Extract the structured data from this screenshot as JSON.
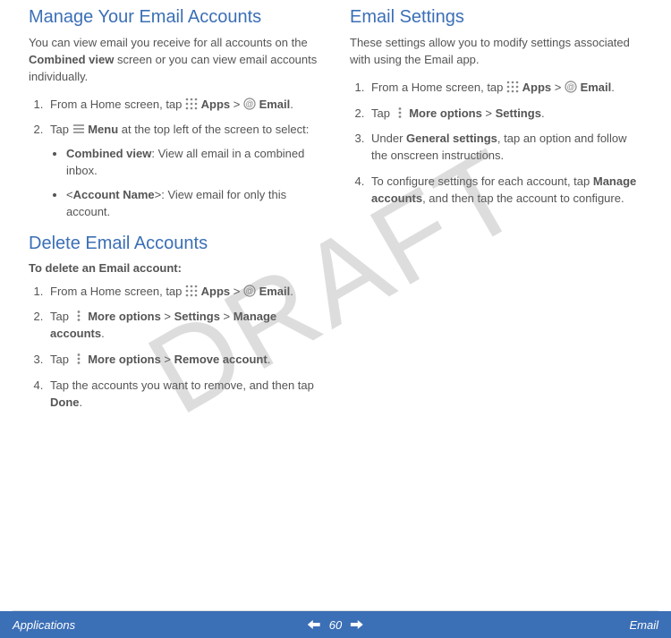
{
  "watermark": "DRAFT",
  "footer": {
    "left": "Applications",
    "page": "60",
    "right": "Email"
  },
  "left": {
    "manage": {
      "title": "Manage Your Email Accounts",
      "intro_a": "You can view email you receive for all accounts on the ",
      "intro_b": "Combined view",
      "intro_c": " screen or you can view email accounts individually.",
      "s1_a": "From a Home screen, tap ",
      "s1_apps": "Apps",
      "s1_gt": " > ",
      "s1_email": "Email",
      "s1_dot": ".",
      "s2_a": "Tap ",
      "s2_menu": "Menu",
      "s2_b": " at the top left of the screen to select:",
      "sub1_a": "Combined view",
      "sub1_b": ": View all email in a combined inbox.",
      "sub2_a": "<",
      "sub2_b": "Account Name",
      "sub2_c": ">: View email for only this account."
    },
    "delete": {
      "title": "Delete Email Accounts",
      "subhead": "To delete an Email account:",
      "s1_a": "From a Home screen, tap ",
      "s1_apps": "Apps",
      "s1_gt": " > ",
      "s1_email": "Email",
      "s1_dot": ".",
      "s2_a": "Tap ",
      "s2_more": "More options",
      "s2_gt1": " > ",
      "s2_settings": "Settings",
      "s2_gt2": " > ",
      "s2_manage": "Manage accounts",
      "s2_dot": ".",
      "s3_a": "Tap ",
      "s3_more": "More options",
      "s3_gt": " > ",
      "s3_remove": "Remove account",
      "s3_dot": ".",
      "s4_a": "Tap the accounts you want to remove, and then tap ",
      "s4_done": "Done",
      "s4_dot": "."
    }
  },
  "right": {
    "settings": {
      "title": "Email Settings",
      "intro": "These settings allow you to modify settings associated with using the Email app.",
      "s1_a": "From a Home screen, tap ",
      "s1_apps": "Apps",
      "s1_gt": " > ",
      "s1_email": "Email",
      "s1_dot": ".",
      "s2_a": "Tap ",
      "s2_more": "More options",
      "s2_gt": " > ",
      "s2_settings": "Settings",
      "s2_dot": ".",
      "s3_a": "Under ",
      "s3_general": "General settings",
      "s3_b": ", tap an option and follow the onscreen instructions.",
      "s4_a": "To configure settings for each account, tap ",
      "s4_manage": "Manage accounts",
      "s4_b": ", and then tap the account to configure."
    }
  }
}
